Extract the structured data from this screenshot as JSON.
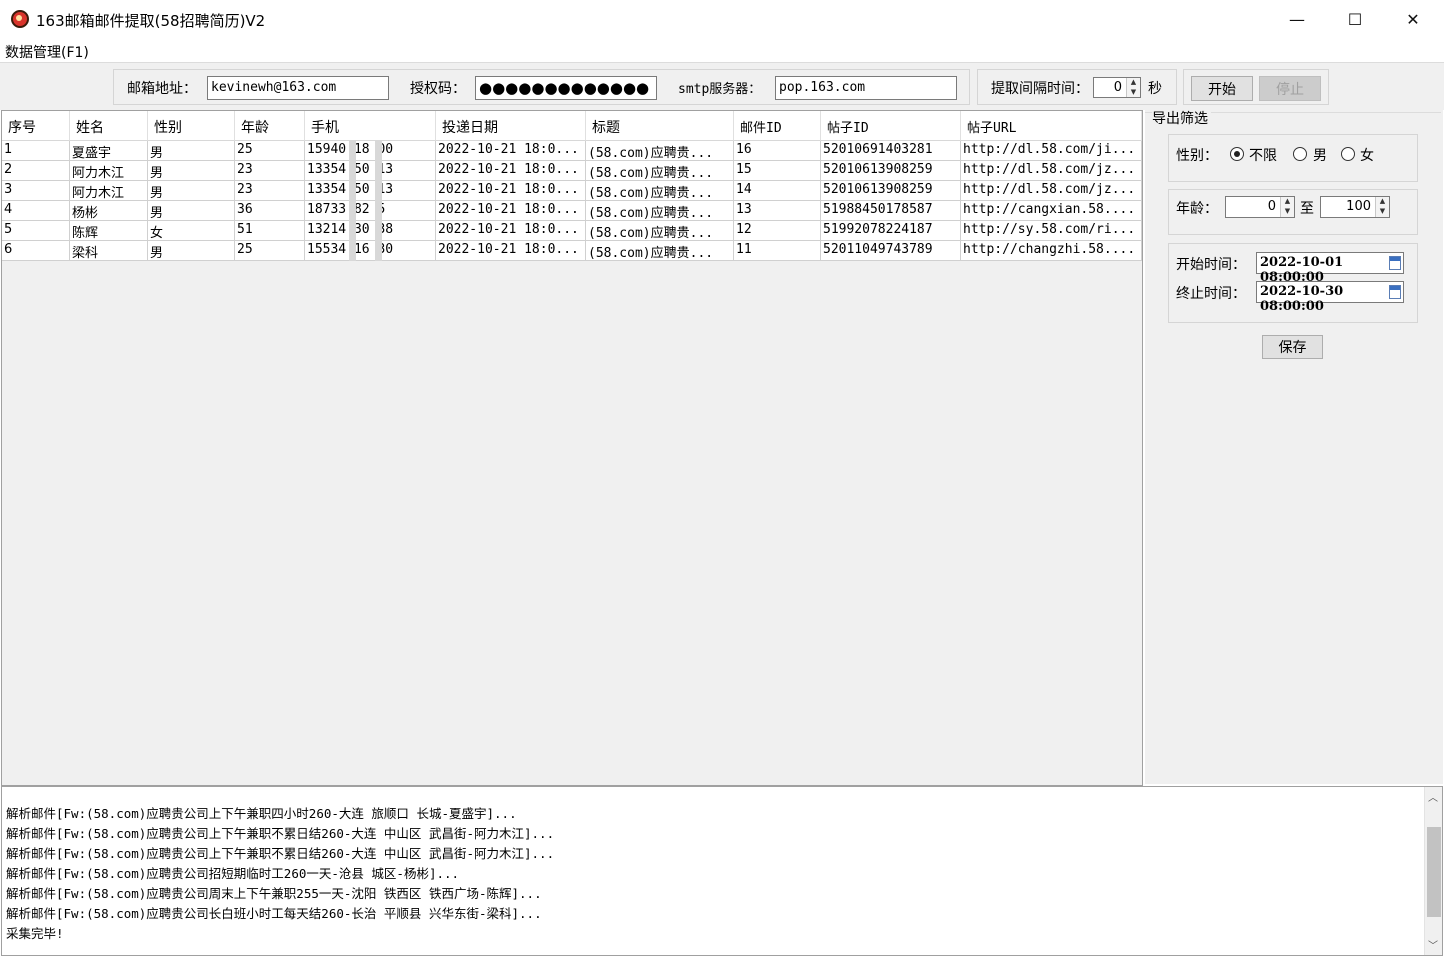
{
  "window": {
    "title": "163邮箱邮件提取(58招聘简历)V2",
    "minimize_glyph": "—",
    "maximize_glyph": "☐",
    "close_glyph": "✕"
  },
  "menu": {
    "data_label": "数据管理(F1)"
  },
  "toolbar": {
    "email_label": "邮箱地址：",
    "email_value": "kevinewh@163.com",
    "auth_label": "授权码：",
    "auth_value": "●●●●●●●●●●●●●",
    "smtp_label": "smtp服务器：",
    "smtp_value": "pop.163.com",
    "interval_label": "提取间隔时间：",
    "interval_value": "0",
    "interval_unit": "秒",
    "start_label": "开始",
    "stop_label": "停止"
  },
  "table": {
    "columns": [
      "序号",
      "姓名",
      "性别",
      "年龄",
      "手机",
      "投递日期",
      "标题",
      "邮件ID",
      "帖子ID",
      "帖子URL"
    ],
    "rows": [
      [
        "1",
        "夏盛宇",
        "男",
        "25",
        "15940 18 00",
        "2022-10-21 18:0...",
        "(58.com)应聘贵...",
        "16",
        "52010691403281",
        "http://dl.58.com/ji..."
      ],
      [
        "2",
        "阿力木江",
        "男",
        "23",
        "13354 50 13",
        "2022-10-21 18:0...",
        "(58.com)应聘贵...",
        "15",
        "52010613908259",
        "http://dl.58.com/jz..."
      ],
      [
        "3",
        "阿力木江",
        "男",
        "23",
        "13354 50 13",
        "2022-10-21 18:0...",
        "(58.com)应聘贵...",
        "14",
        "52010613908259",
        "http://dl.58.com/jz..."
      ],
      [
        "4",
        "杨彬",
        "男",
        "36",
        "18733 82 5",
        "2022-10-21 18:0...",
        "(58.com)应聘贵...",
        "13",
        "51988450178587",
        "http://cangxian.58...."
      ],
      [
        "5",
        "陈辉",
        "女",
        "51",
        "13214 30 38",
        "2022-10-21 18:0...",
        "(58.com)应聘贵...",
        "12",
        "51992078224187",
        "http://sy.58.com/ri..."
      ],
      [
        "6",
        "梁科",
        "男",
        "25",
        "15534 16 30",
        "2022-10-21 18:0...",
        "(58.com)应聘贵...",
        "11",
        "52011049743789",
        "http://changzhi.58...."
      ]
    ]
  },
  "export": {
    "title": "导出筛选",
    "gender_label": "性别：",
    "gender_options": [
      "不限",
      "男",
      "女"
    ],
    "gender_selected": "不限",
    "age_label": "年龄：",
    "age_min": "0",
    "age_to": "至",
    "age_max": "100",
    "start_time_label": "开始时间：",
    "start_time_value": "2022-10-01 08:00:00",
    "end_time_label": "终止时间：",
    "end_time_value": "2022-10-30 08:00:00",
    "save_label": "保存"
  },
  "log": {
    "lines": [
      "解析邮件[Fw:(58.com)应聘贵公司上下午兼职四小时260-大连 旅顺口 长城-夏盛宇]...",
      "解析邮件[Fw:(58.com)应聘贵公司上下午兼职不累日结260-大连 中山区 武昌街-阿力木江]...",
      "解析邮件[Fw:(58.com)应聘贵公司上下午兼职不累日结260-大连 中山区 武昌街-阿力木江]...",
      "解析邮件[Fw:(58.com)应聘贵公司招短期临时工260一天-沧县 城区-杨彬]...",
      "解析邮件[Fw:(58.com)应聘贵公司周末上下午兼职255一天-沈阳 铁西区 铁西广场-陈辉]...",
      "解析邮件[Fw:(58.com)应聘贵公司长白班小时工每天结260-长治 平顺县 兴华东街-梁科]...",
      "采集完毕!"
    ]
  }
}
